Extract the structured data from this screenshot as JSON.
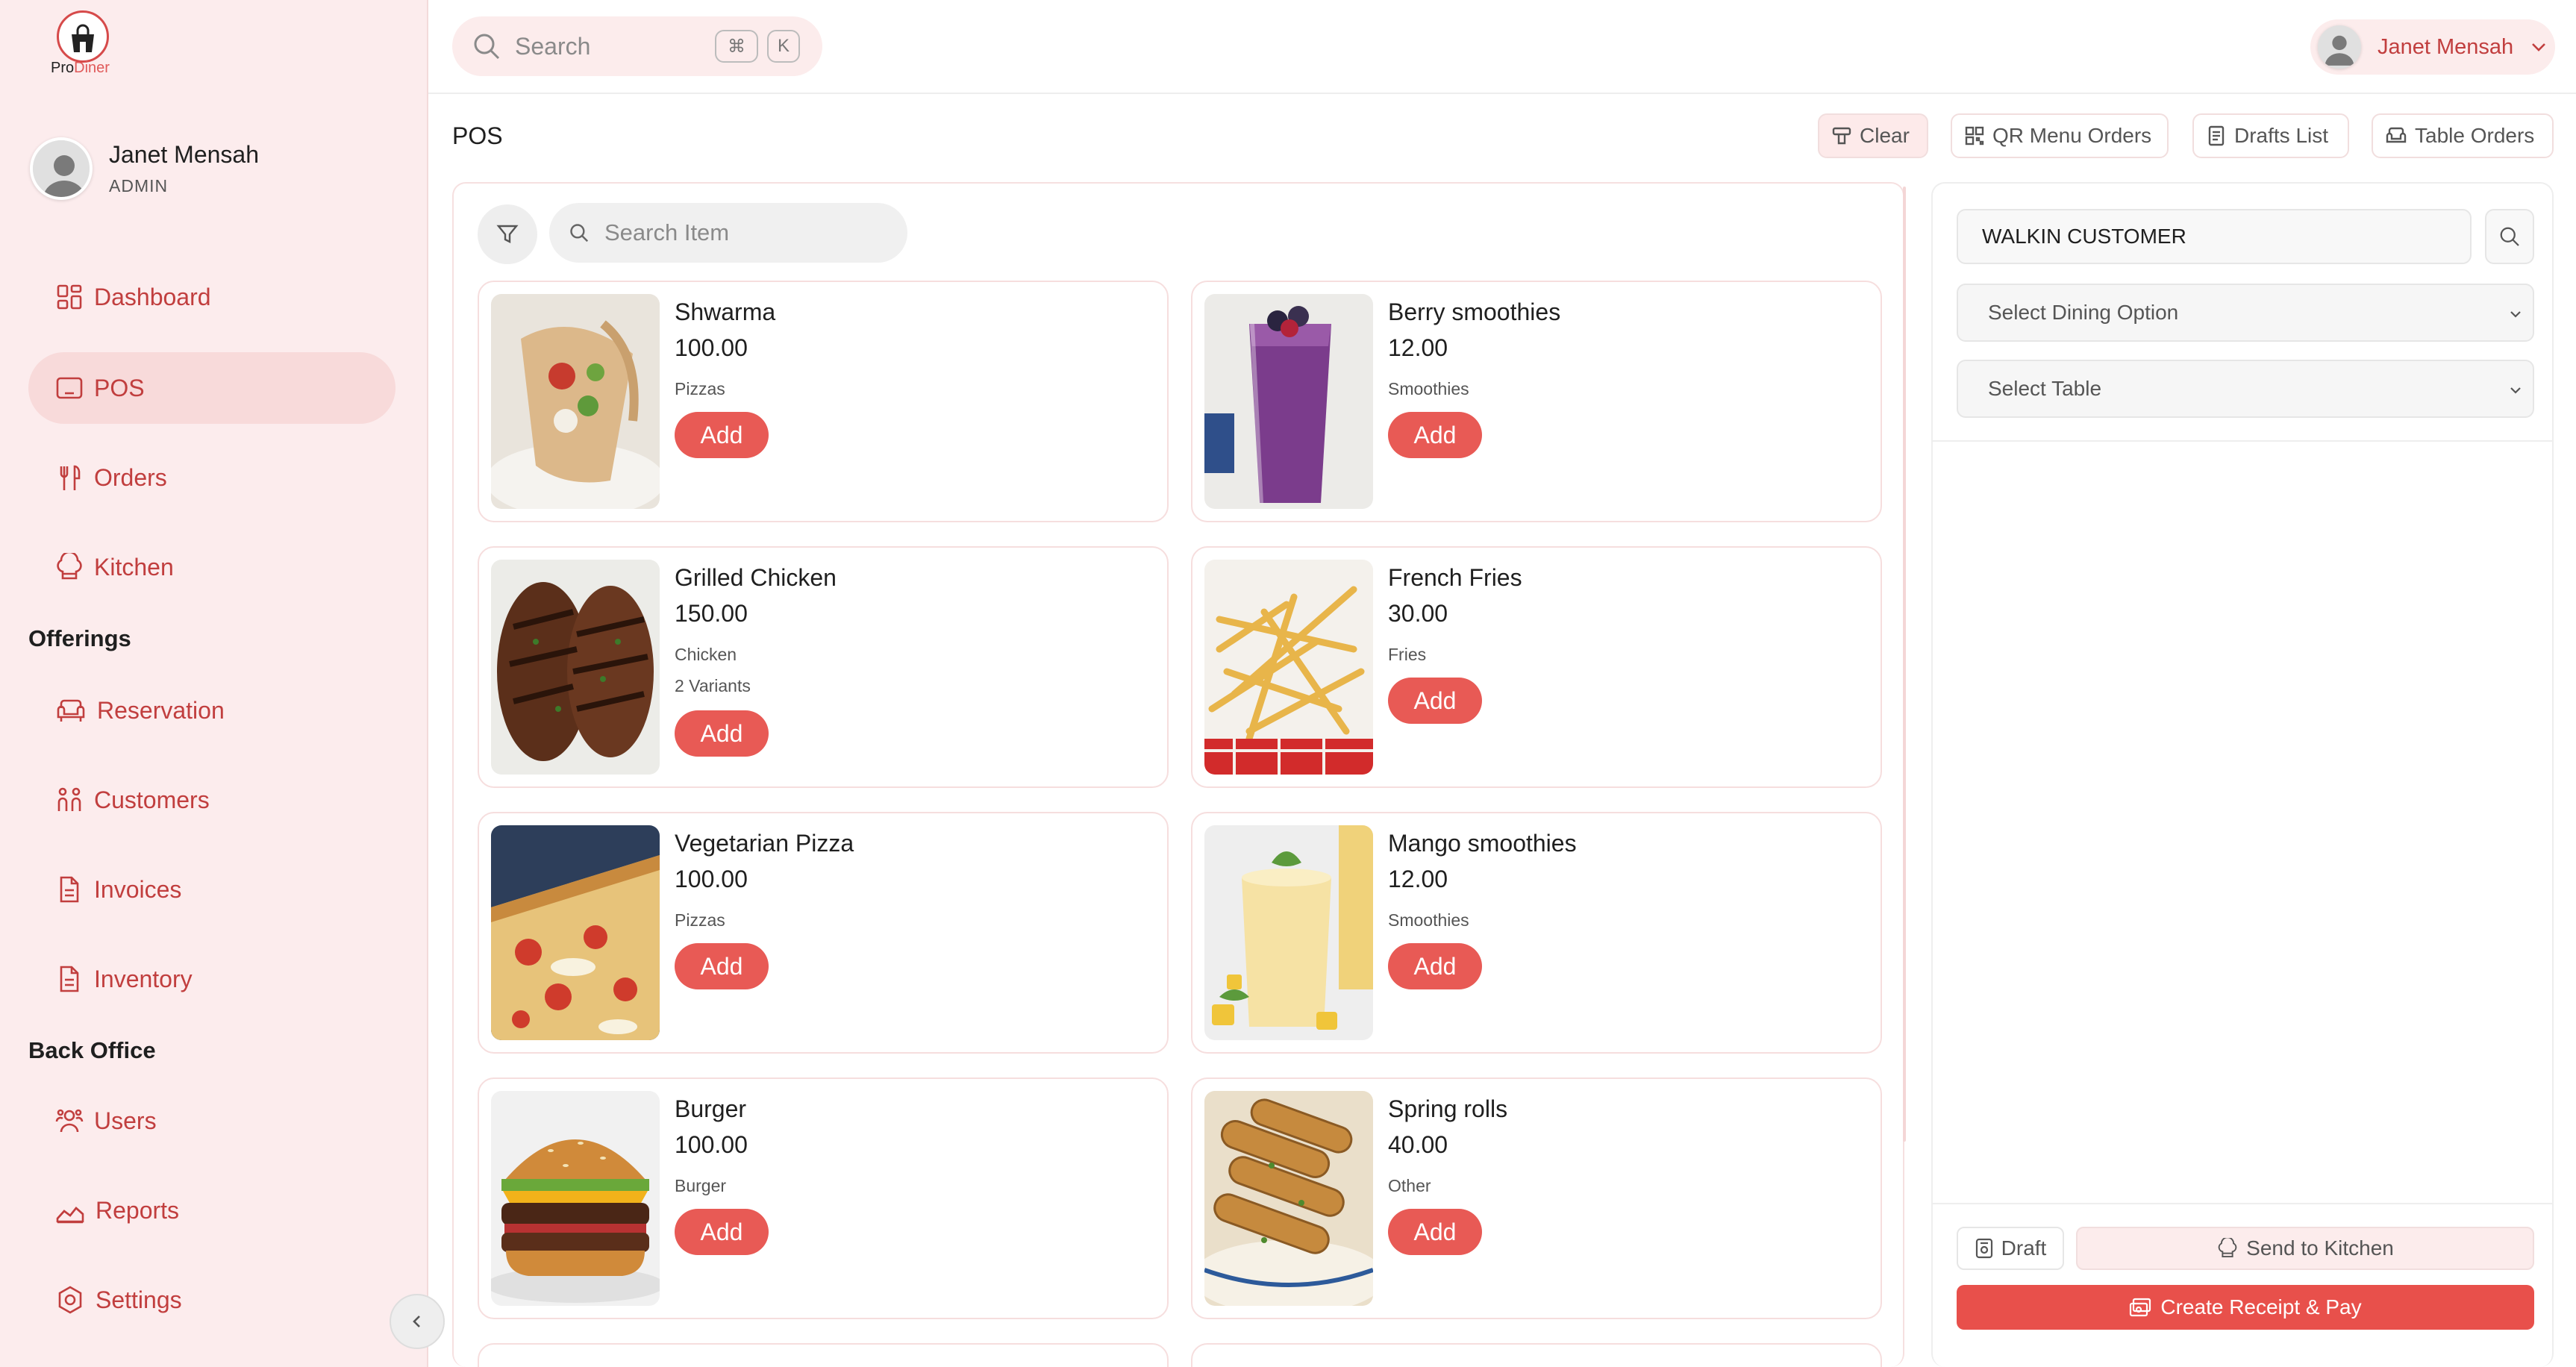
{
  "brand": {
    "part1": "Pro",
    "part2": "Diner"
  },
  "user": {
    "name": "Janet Mensah",
    "role": "ADMIN"
  },
  "sidebar": {
    "main_items": [
      {
        "label": "Dashboard",
        "icon": "dashboard-icon"
      },
      {
        "label": "POS",
        "icon": "tablet-icon",
        "active": true
      },
      {
        "label": "Orders",
        "icon": "utensils-icon"
      },
      {
        "label": "Kitchen",
        "icon": "chef-hat-icon"
      }
    ],
    "offerings_title": "Offerings",
    "offerings_items": [
      {
        "label": "Reservation",
        "icon": "sofa-icon"
      },
      {
        "label": "Customers",
        "icon": "people-icon"
      },
      {
        "label": "Invoices",
        "icon": "document-icon"
      },
      {
        "label": "Inventory",
        "icon": "document-icon"
      }
    ],
    "backoffice_title": "Back Office",
    "backoffice_items": [
      {
        "label": "Users",
        "icon": "users-icon"
      },
      {
        "label": "Reports",
        "icon": "chart-icon"
      },
      {
        "label": "Settings",
        "icon": "gear-icon"
      }
    ]
  },
  "topbar": {
    "search_placeholder": "Search",
    "kbd1": "⌘",
    "kbd2": "K",
    "user_name": "Janet Mensah"
  },
  "pos": {
    "title": "POS",
    "buttons": {
      "clear": "Clear",
      "qr": "QR Menu Orders",
      "drafts": "Drafts List",
      "table": "Table Orders"
    },
    "item_search_placeholder": "Search Item",
    "add_label": "Add",
    "items": [
      {
        "name": "Shwarma",
        "price": "100.00",
        "category": "Pizzas",
        "variants": ""
      },
      {
        "name": "Berry smoothies",
        "price": "12.00",
        "category": "Smoothies",
        "variants": ""
      },
      {
        "name": "Grilled Chicken",
        "price": "150.00",
        "category": "Chicken",
        "variants": "2 Variants"
      },
      {
        "name": "French Fries",
        "price": "30.00",
        "category": "Fries",
        "variants": ""
      },
      {
        "name": "Vegetarian Pizza",
        "price": "100.00",
        "category": "Pizzas",
        "variants": ""
      },
      {
        "name": "Mango smoothies",
        "price": "12.00",
        "category": "Smoothies",
        "variants": ""
      },
      {
        "name": "Burger",
        "price": "100.00",
        "category": "Burger",
        "variants": ""
      },
      {
        "name": "Spring rolls",
        "price": "40.00",
        "category": "Other",
        "variants": ""
      }
    ]
  },
  "order": {
    "customer": "WALKIN CUSTOMER",
    "dining_placeholder": "Select Dining Option",
    "table_placeholder": "Select Table",
    "draft": "Draft",
    "kitchen": "Send to Kitchen",
    "pay": "Create Receipt & Pay"
  },
  "colors": {
    "accent": "#e85a55",
    "sidebar_bg": "#fceced",
    "nav_text": "#c13e3e"
  }
}
